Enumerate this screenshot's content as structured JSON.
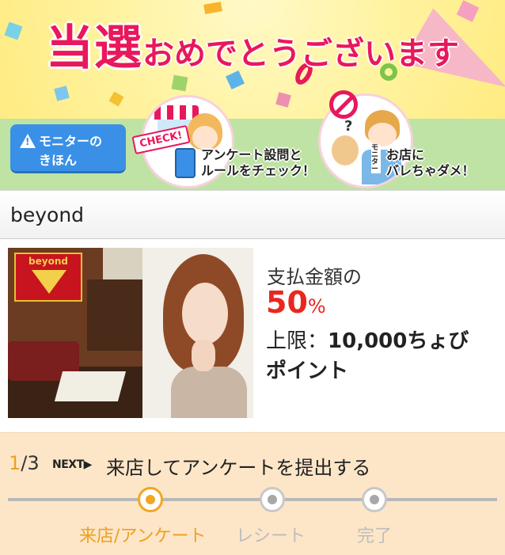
{
  "banner": {
    "title_main": "当選",
    "title_sub": "おめでとうございます",
    "monitor_button": {
      "line1": "モニターの",
      "line2": "きほん"
    },
    "check_badge": "CHECK!",
    "step_survey": {
      "line1": "アンケート設問と",
      "line2": "ルールをチェック！"
    },
    "step_secret": {
      "line1": "お店に",
      "line2": "バレちゃダメ！"
    },
    "vest_label": "モニター"
  },
  "shop": {
    "name": "beyond"
  },
  "info": {
    "logo_text": "beyond",
    "pay_label": "支払金額の",
    "pay_rate": "50",
    "pay_unit": "%",
    "limit_label": "上限：",
    "limit_amount": "10,000ちょび",
    "limit_unit": "ポイント"
  },
  "progress": {
    "current": "1",
    "total": "/3",
    "next_tag": "NEXT▶",
    "description": "来店してアンケートを提出する",
    "steps": [
      {
        "label": "来店/アンケート",
        "state": "active"
      },
      {
        "label": "レシート",
        "state": "pending"
      },
      {
        "label": "完了",
        "state": "pending"
      }
    ]
  },
  "colors": {
    "accent_pink": "#e8185c",
    "progress_orange": "#f3a623",
    "rate_red": "#e8281e",
    "monitor_blue": "#3a90e6"
  }
}
